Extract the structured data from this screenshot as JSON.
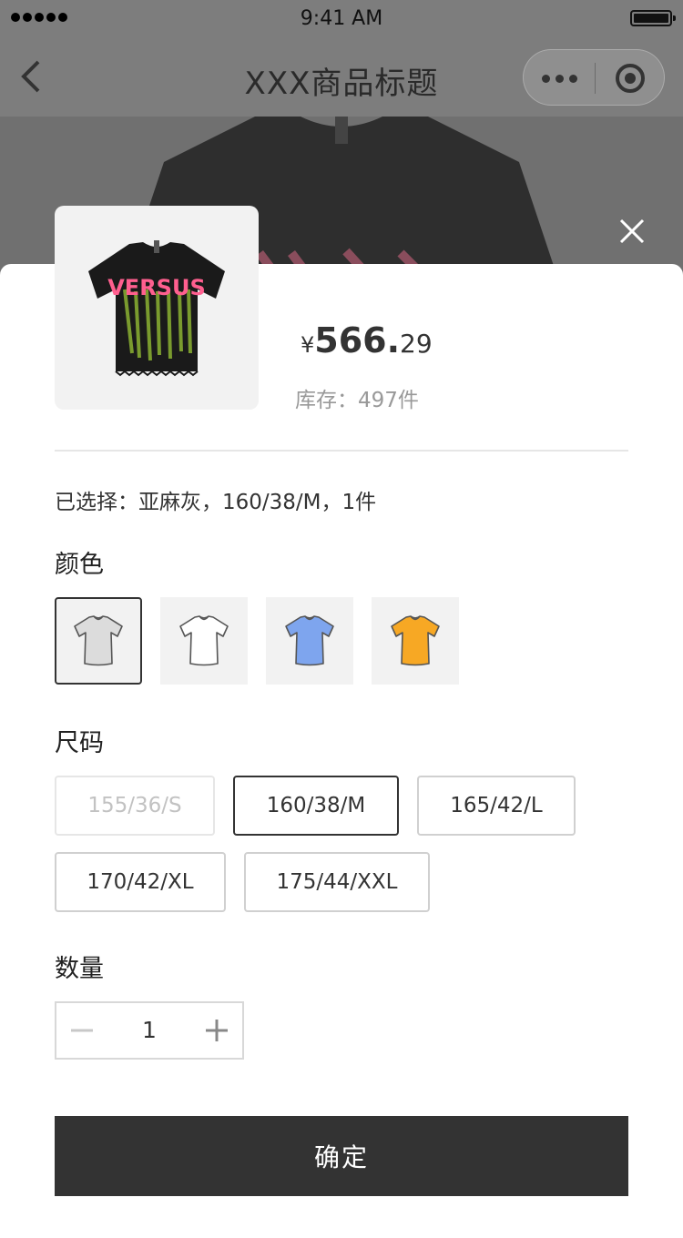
{
  "status_bar": {
    "time": "9:41 AM"
  },
  "nav": {
    "title": "XXX商品标题"
  },
  "product": {
    "currency": "¥",
    "price_int": "566.",
    "price_dec": "29",
    "stock": "库存：497件",
    "print_text": "VERSUS"
  },
  "selection": {
    "summary": "已选择：亚麻灰，160/38/M，1件"
  },
  "color_section": {
    "title": "颜色",
    "options": [
      {
        "color": "#dcdcdc",
        "selected": true
      },
      {
        "color": "#ffffff",
        "selected": false
      },
      {
        "color": "#7ea5ee",
        "selected": false
      },
      {
        "color": "#f7a824",
        "selected": false
      }
    ]
  },
  "size_section": {
    "title": "尺码",
    "options": [
      {
        "label": "155/36/S",
        "state": "disabled"
      },
      {
        "label": "160/38/M",
        "state": "selected"
      },
      {
        "label": "165/42/L",
        "state": "normal"
      },
      {
        "label": "170/42/XL",
        "state": "normal"
      },
      {
        "label": "175/44/XXL",
        "state": "normal"
      }
    ]
  },
  "quantity_section": {
    "title": "数量",
    "value": "1"
  },
  "confirm": {
    "label": "确定"
  }
}
